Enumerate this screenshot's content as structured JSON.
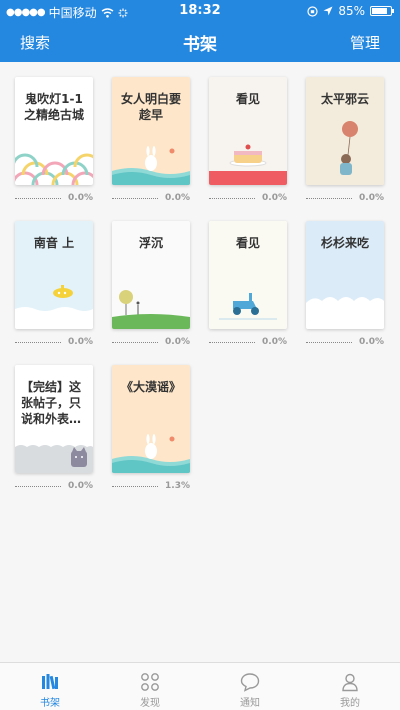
{
  "status_bar": {
    "carrier": "中国移动",
    "time": "18:32",
    "battery": "85%",
    "battery_level": 0.85
  },
  "nav": {
    "left": "搜索",
    "title": "书架",
    "right": "管理"
  },
  "books": [
    {
      "title": "鬼吹灯1-1之精绝古城",
      "progress": "0.0%"
    },
    {
      "title": "女人明白要趁早",
      "progress": "0.0%"
    },
    {
      "title": "看见",
      "progress": "0.0%"
    },
    {
      "title": "太平邪云",
      "progress": "0.0%"
    },
    {
      "title": "南音 上",
      "progress": "0.0%"
    },
    {
      "title": "浮沉",
      "progress": "0.0%"
    },
    {
      "title": "看见",
      "progress": "0.0%"
    },
    {
      "title": "杉杉来吃",
      "progress": "0.0%"
    },
    {
      "title": "【完结】这张帖子，只说和外表…",
      "progress": "0.0%"
    },
    {
      "title": "《大漠谣》",
      "progress": "1.3%"
    }
  ],
  "tabs": [
    {
      "label": "书架",
      "icon": "bookshelf-icon",
      "active": true
    },
    {
      "label": "发现",
      "icon": "grid-icon",
      "active": false
    },
    {
      "label": "通知",
      "icon": "chat-bubble-icon",
      "active": false
    },
    {
      "label": "我的",
      "icon": "person-icon",
      "active": false
    }
  ],
  "colors": {
    "accent": "#2487e0"
  }
}
